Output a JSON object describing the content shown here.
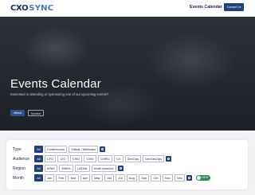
{
  "header": {
    "logo_mark": "CXO",
    "logo_text": "SYNC",
    "nav_link": "Events Calendar",
    "contact_button": "Contact Us"
  },
  "hero": {
    "title": "Events Calendar",
    "subtitle": "Interested in attending or sponsoring one of our upcoming events?",
    "button_primary": "Attend",
    "button_secondary": "Sponsor"
  },
  "filters": {
    "type": {
      "label": "Type",
      "options": [
        "All",
        "Conferences",
        "Virtual / Webinars"
      ]
    },
    "audience": {
      "label": "Audience",
      "options": [
        "All",
        "CFO",
        "CIO",
        "CISO",
        "CMO",
        "CHRO",
        "CX",
        "DevOps",
        "DevSecOps"
      ]
    },
    "region": {
      "label": "Region",
      "options": [
        "All",
        "APAC",
        "EMEA",
        "LATAM",
        "North America"
      ]
    },
    "month": {
      "label": "Month",
      "options": [
        "All",
        "Jan",
        "Feb",
        "Mar",
        "Apr",
        "May",
        "Jun",
        "Jul",
        "Aug",
        "Sep",
        "Oct",
        "Nov",
        "Dec"
      ],
      "toggle_label": "NEW"
    }
  },
  "colors": {
    "brand_dark": "#1a2b5c",
    "brand_accent": "#3e7ac4",
    "active_chip": "#24407a",
    "toggle": "#2f8b52"
  }
}
